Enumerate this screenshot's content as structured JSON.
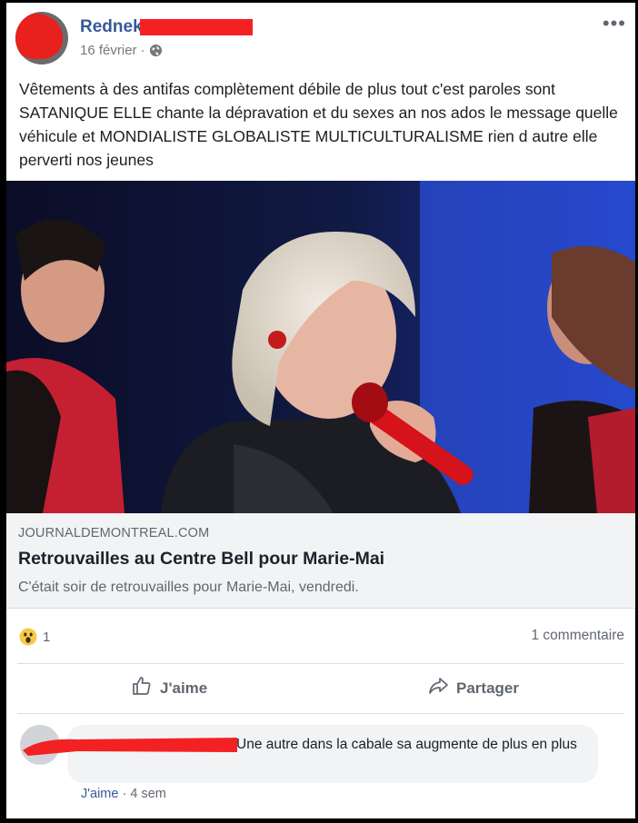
{
  "post": {
    "author": "Rednek",
    "date": "16 février",
    "date_separator": "·",
    "privacy_icon": "globe-icon",
    "more_icon": "more-horizontal-icon",
    "text": "Vêtements à des antifas complètement débile de plus tout c'est paroles sont SATANIQUE ELLE chante la dépravation et du sexes an nos ados le message quelle véhicule et MONDIALISTE GLOBALISTE MULTICULTURALISME rien d autre elle perverti nos jeunes"
  },
  "link_preview": {
    "domain": "JOURNALDEMONTREAL.COM",
    "title": "Retrouvailles au Centre Bell pour Marie-Mai",
    "description": "C'était soir de retrouvailles pour Marie-Mai, vendredi."
  },
  "reactions": {
    "icon": "wow-emoji-icon",
    "count": "1",
    "comments": "1 commentaire"
  },
  "actions": {
    "like": "J'aime",
    "share": "Partager"
  },
  "comment": {
    "text": "Une autre dans la cabale sa augmente de plus en plus",
    "like": "J'aime",
    "separator": "·",
    "time": "4 sem"
  },
  "colors": {
    "link_blue": "#385898",
    "redaction_red": "#f42123",
    "meta_gray": "#606770"
  }
}
